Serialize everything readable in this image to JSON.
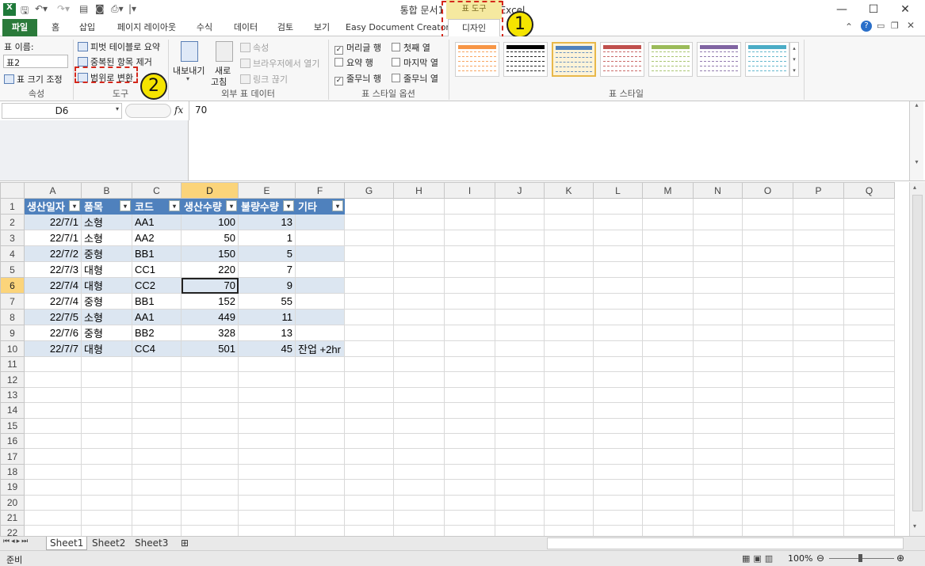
{
  "window": {
    "title": "통합 문서1 - Microsoft Excel",
    "contextual_group": "표 도구"
  },
  "tabs": [
    "파일",
    "홈",
    "삽입",
    "페이지 레이아웃",
    "수식",
    "데이터",
    "검토",
    "보기",
    "Easy Document Creator",
    "디자인"
  ],
  "ribbon": {
    "props": {
      "name_label": "표 이름:",
      "name_value": "표2",
      "resize": "표 크기 조정",
      "group": "속성"
    },
    "tools": {
      "pivot": "피벗 테이블로 요약",
      "dedupe": "중복된 항목 제거",
      "convert": "범위로 변환",
      "group": "도구"
    },
    "external": {
      "export": "내보내기",
      "refresh": "새로",
      "refresh2": "고침",
      "properties": "속성",
      "browser": "브라우저에서 열기",
      "unlink": "링크 끊기",
      "group": "외부 표 데이터"
    },
    "options": {
      "header_row": "머리글 행",
      "total_row": "요약 행",
      "banded_rows": "줄무늬 행",
      "first_col": "첫째 열",
      "last_col": "마지막 열",
      "banded_cols": "줄무늬 열",
      "group": "표 스타일 옵션"
    },
    "styles": {
      "group": "표 스타일",
      "colors": [
        "#f79646",
        "#000000",
        "#4f81bd",
        "#c0504d",
        "#9bbb59",
        "#8064a2",
        "#4bacc6"
      ]
    }
  },
  "annotations": {
    "one": "1",
    "two": "2"
  },
  "formula": {
    "cell_ref": "D6",
    "fx": "fx",
    "value": "70"
  },
  "columns": [
    "A",
    "B",
    "C",
    "D",
    "E",
    "F",
    "G",
    "H",
    "I",
    "J",
    "K",
    "L",
    "M",
    "N",
    "O",
    "P",
    "Q"
  ],
  "table_headers": [
    "생산일자",
    "품목",
    "코드",
    "생산수량",
    "불량수량",
    "기타"
  ],
  "rows": [
    [
      "22/7/1",
      "소형",
      "AA1",
      "100",
      "13",
      ""
    ],
    [
      "22/7/1",
      "소형",
      "AA2",
      "50",
      "1",
      ""
    ],
    [
      "22/7/2",
      "중형",
      "BB1",
      "150",
      "5",
      ""
    ],
    [
      "22/7/3",
      "대형",
      "CC1",
      "220",
      "7",
      ""
    ],
    [
      "22/7/4",
      "대형",
      "CC2",
      "70",
      "9",
      ""
    ],
    [
      "22/7/4",
      "중형",
      "BB1",
      "152",
      "55",
      ""
    ],
    [
      "22/7/5",
      "소형",
      "AA1",
      "449",
      "11",
      ""
    ],
    [
      "22/7/6",
      "중형",
      "BB2",
      "328",
      "13",
      ""
    ],
    [
      "22/7/7",
      "대형",
      "CC4",
      "501",
      "45",
      "잔업 +2hr"
    ]
  ],
  "row_numbers": [
    "1",
    "2",
    "3",
    "4",
    "5",
    "6",
    "7",
    "8",
    "9",
    "10",
    "11",
    "12",
    "13",
    "14",
    "15",
    "16",
    "17",
    "18",
    "19",
    "20",
    "21",
    "22"
  ],
  "sheets": [
    "Sheet1",
    "Sheet2",
    "Sheet3"
  ],
  "status": {
    "ready": "준비",
    "zoom": "100%"
  }
}
